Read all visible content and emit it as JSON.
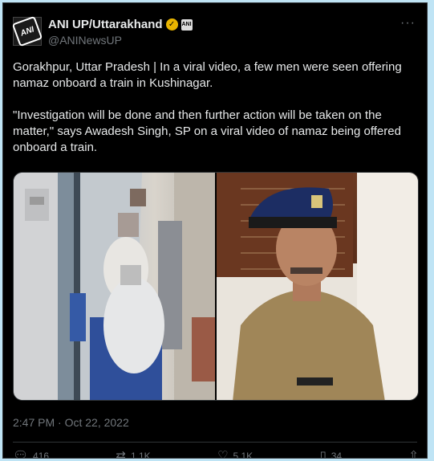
{
  "author": {
    "display_name": "ANI UP/Uttarakhand",
    "handle": "@ANINewsUP",
    "avatar_text": "ANI",
    "affiliate_badge_text": "ANI"
  },
  "more_label": "···",
  "tweet": {
    "paragraph_1": "Gorakhpur, Uttar Pradesh | In a viral video, a few men were seen offering namaz onboard a train in Kushinagar.",
    "paragraph_2": "\"Investigation will be done and then further action will be taken on the matter,\" says Awadesh Singh, SP on a viral video of namaz being offered onboard a train."
  },
  "timestamp": "2:47 PM · Oct 22, 2022",
  "metrics": {
    "replies": "416",
    "retweets": "1.1K",
    "likes": "5.1K",
    "bookmarks": "34"
  },
  "icons": {
    "reply": "reply-icon",
    "retweet": "retweet-icon",
    "like": "like-icon",
    "bookmark": "bookmark-icon",
    "share": "share-icon"
  },
  "colors": {
    "background": "#000000",
    "text": "#e7e9ea",
    "secondary": "#71767b",
    "border": "#2f3336",
    "page": "#bfe4f5",
    "verified": "#e8b400"
  }
}
